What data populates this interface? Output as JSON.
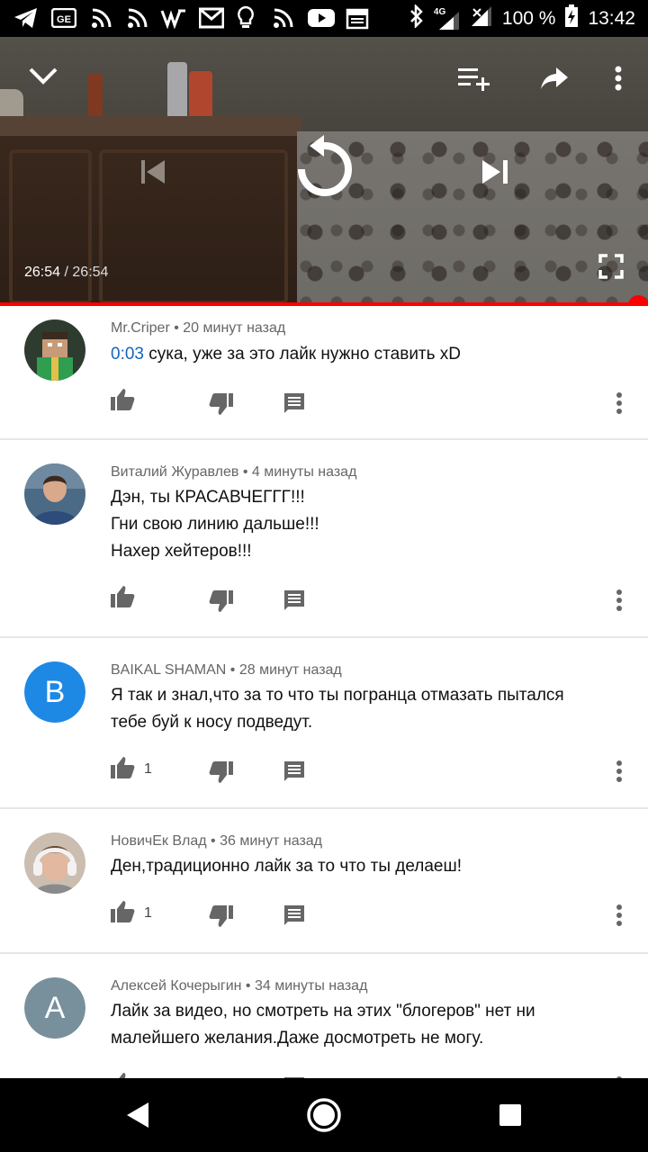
{
  "status_bar": {
    "icons": [
      "telegram-icon",
      "ge-icon",
      "rss-icon",
      "rss-icon",
      "vk-icon",
      "gmail-icon",
      "lightbulb-icon",
      "rss-icon",
      "youtube-icon",
      "calendar-icon",
      "bluetooth-icon",
      "signal-4g-icon",
      "signal-icon",
      "battery-icon"
    ],
    "network": "4G",
    "battery": "100 %",
    "time": "13:42"
  },
  "player": {
    "current_time": "26:54",
    "separator": " / ",
    "duration": "26:54",
    "progress": 1.0,
    "accent": "#ff0000"
  },
  "comments": [
    {
      "author": "Mr.Criper",
      "sep": " • ",
      "ago": "20 минут назад",
      "timestamp": "0:03",
      "lines": [
        " сука, уже за это лайк нужно ставить xD"
      ],
      "likes": "",
      "avatar_type": "image",
      "avatar_color": "#2d6b35"
    },
    {
      "author": "Виталий Журавлев",
      "sep": " • ",
      "ago": "4 минуты назад",
      "lines": [
        "Дэн, ты КРАСАВЧЕГГГ!!!",
        "Гни свою линию дальше!!!",
        "Нахер хейтеров!!!"
      ],
      "likes": "",
      "avatar_type": "image",
      "avatar_color": "#4b6a86"
    },
    {
      "author": "BAIKAL SHAMAN",
      "sep": " • ",
      "ago": "28 минут назад",
      "lines": [
        "Я так и знал,что за то что ты погранца отмазать пытался",
        "тебе буй к носу подведут."
      ],
      "likes": "1",
      "avatar_type": "letter",
      "avatar_letter": "B",
      "avatar_color": "#1e88e5"
    },
    {
      "author": "НовичЕк Влад",
      "sep": " • ",
      "ago": "36 минут назад",
      "lines": [
        "Ден,традиционно лайк за то что ты делаеш!"
      ],
      "likes": "1",
      "avatar_type": "image",
      "avatar_color": "#b08e78"
    },
    {
      "author": "Алексей Кочерыгин",
      "sep": " • ",
      "ago": "34 минуты назад",
      "lines": [
        "Лайк за видео, но смотреть на этих \"блогеров\" нет ни",
        "малейшего желания.Даже досмотреть не могу."
      ],
      "likes": "",
      "avatar_type": "letter",
      "avatar_letter": "A",
      "avatar_color": "#78909c"
    }
  ],
  "nav": {
    "back": "back-icon",
    "home": "home-icon",
    "recents": "recents-icon"
  }
}
